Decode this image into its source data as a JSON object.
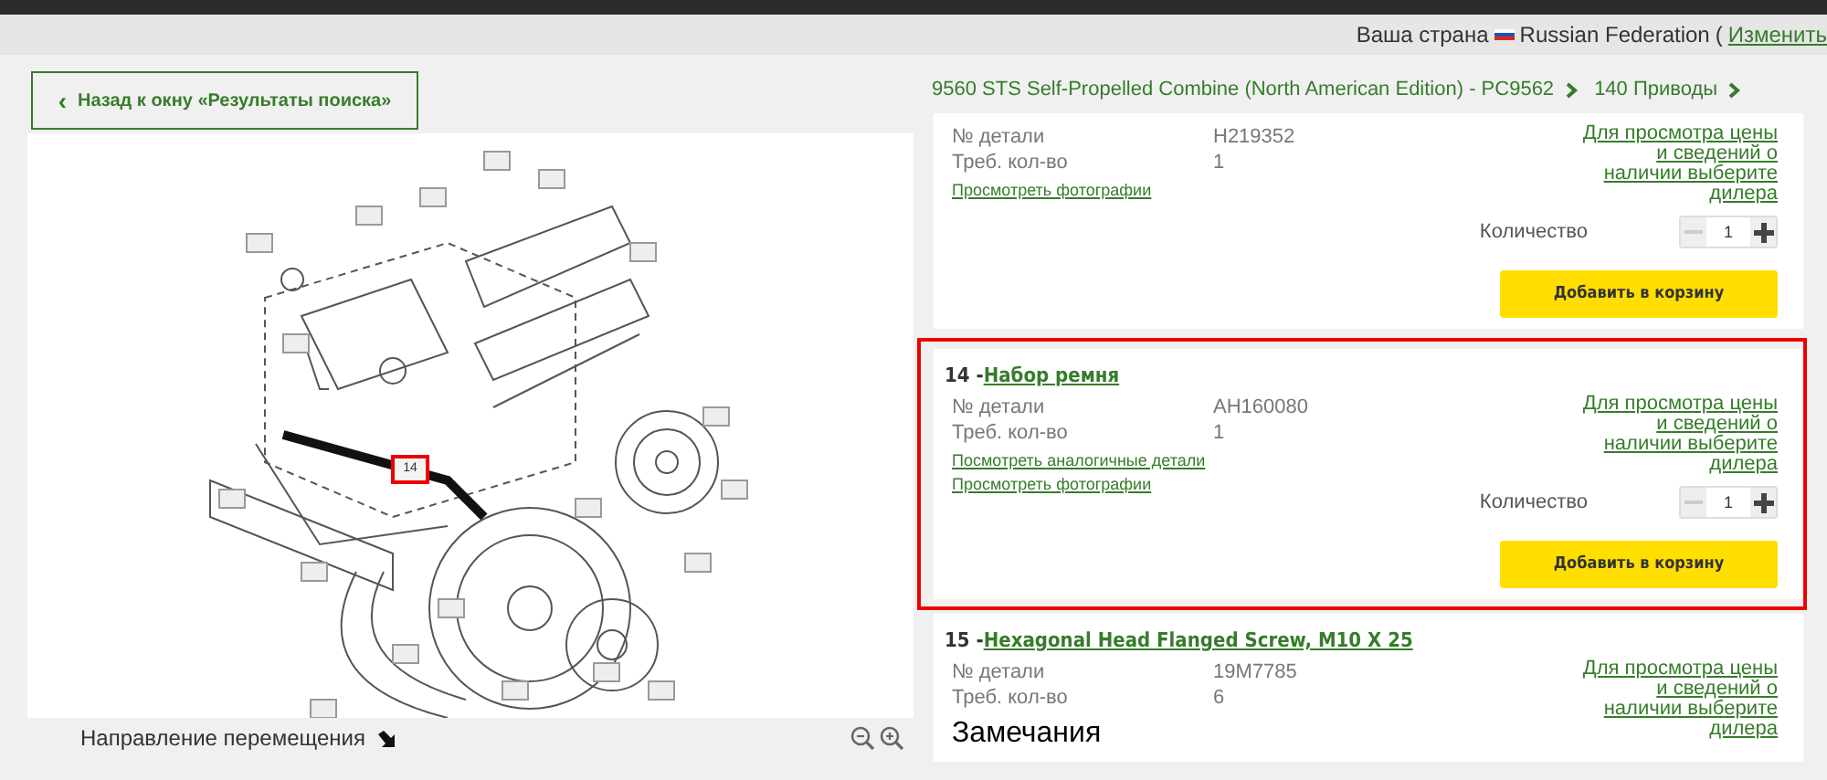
{
  "country_bar": {
    "label": "Ваша страна",
    "country": "Russian Federation",
    "open_paren": "(",
    "change_link": "Изменить"
  },
  "back_button": {
    "icon": "‹",
    "label": "Назад к окну «Результаты поиска»"
  },
  "diagram": {
    "highlighted_callout": "14",
    "footer_label": "Направление перемещения"
  },
  "breadcrumbs": [
    {
      "label": "9560 STS Self-Propelled Combine (North American Edition) - PC9562"
    },
    {
      "label": "140 Приводы"
    }
  ],
  "parts": [
    {
      "selected": false,
      "fields": [
        {
          "label": "№ детали",
          "value": "H219352"
        },
        {
          "label": "Треб. кол-во",
          "value": "1"
        }
      ],
      "links": [
        "Просмотреть фотографии"
      ],
      "price_link": "Для просмотра цены и сведений о наличии выберите дилера",
      "quantity_label": "Количество",
      "quantity": "1",
      "cart_button": "Добавить в корзину"
    },
    {
      "index": "14 -",
      "title": "Набор ремня",
      "selected": true,
      "fields": [
        {
          "label": "№ детали",
          "value": "AH160080"
        },
        {
          "label": "Треб. кол-во",
          "value": "1"
        }
      ],
      "links": [
        "Посмотреть аналогичные детали",
        "Просмотреть фотографии"
      ],
      "price_link": "Для просмотра цены и сведений о наличии выберите дилера",
      "quantity_label": "Количество",
      "quantity": "1",
      "cart_button": "Добавить в корзину"
    },
    {
      "index": "15 -",
      "title": "Hexagonal Head Flanged Screw, M10 X 25",
      "selected": false,
      "fields": [
        {
          "label": "№ детали",
          "value": "19M7785"
        },
        {
          "label": "Треб. кол-во",
          "value": "6"
        }
      ],
      "notes_label": "Замечания",
      "price_link": "Для просмотра цены и сведений о наличии выберите дилера"
    }
  ]
}
